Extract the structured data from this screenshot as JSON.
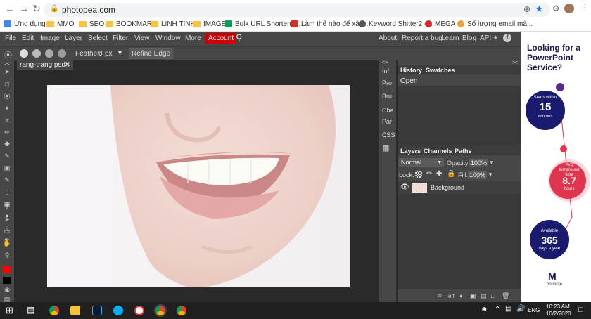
{
  "browser": {
    "url": "photopea.com",
    "bookmarks": [
      "Ứng dụng",
      "MMO",
      "SEO",
      "BOOKMARK",
      "LINH TINH",
      "IMAGE",
      "Bulk URL Shortener...",
      "Làm thế nào để xây...",
      "Keyword Shitter2 -...",
      "MEGA",
      "Số lượng email mà..."
    ]
  },
  "menu": {
    "items": [
      "File",
      "Edit",
      "Image",
      "Layer",
      "Select",
      "Filter",
      "View",
      "Window",
      "More"
    ],
    "account": "Account",
    "right": [
      "About",
      "Report a bug",
      "Learn",
      "Blog",
      "API"
    ]
  },
  "options": {
    "feather_label": "Feather:",
    "feather_value": "0",
    "feather_unit": "px",
    "refine": "Refine Edge"
  },
  "document": {
    "tab": "rang-trang.psd"
  },
  "side_icons": [
    "Inf",
    "Pro",
    "Bru",
    "Cha",
    "Par",
    "CSS"
  ],
  "history": {
    "tabs": [
      "History",
      "Swatches"
    ],
    "items": [
      "Open"
    ]
  },
  "layers": {
    "tabs": [
      "Layers",
      "Channels",
      "Paths"
    ],
    "blend_mode": "Normal",
    "opacity_label": "Opacity:",
    "opacity": "100%",
    "lock_label": "Lock:",
    "fill_label": "Fill:",
    "fill": "100%",
    "layer_name": "Background",
    "footer_eff": "eff"
  },
  "ad": {
    "headline": "Looking for a PowerPoint Service?",
    "stat1_top": "Starts within",
    "stat1_num": "15",
    "stat1_unit": "minutes",
    "stat2_top": "Avg turnaround time",
    "stat2_num": "8.7",
    "stat2_unit": "hours",
    "stat3_top": "Available",
    "stat3_num": "365",
    "stat3_unit": "days a year",
    "brand": "no more"
  },
  "taskbar": {
    "lang": "ENG",
    "time": "10:23 AM",
    "date": "10/2/2020"
  },
  "colors": {
    "accent": "#cc0000",
    "primary_fg": "#ff0000",
    "ad_navy": "#1a1a6e",
    "ad_red": "#e0354e"
  }
}
